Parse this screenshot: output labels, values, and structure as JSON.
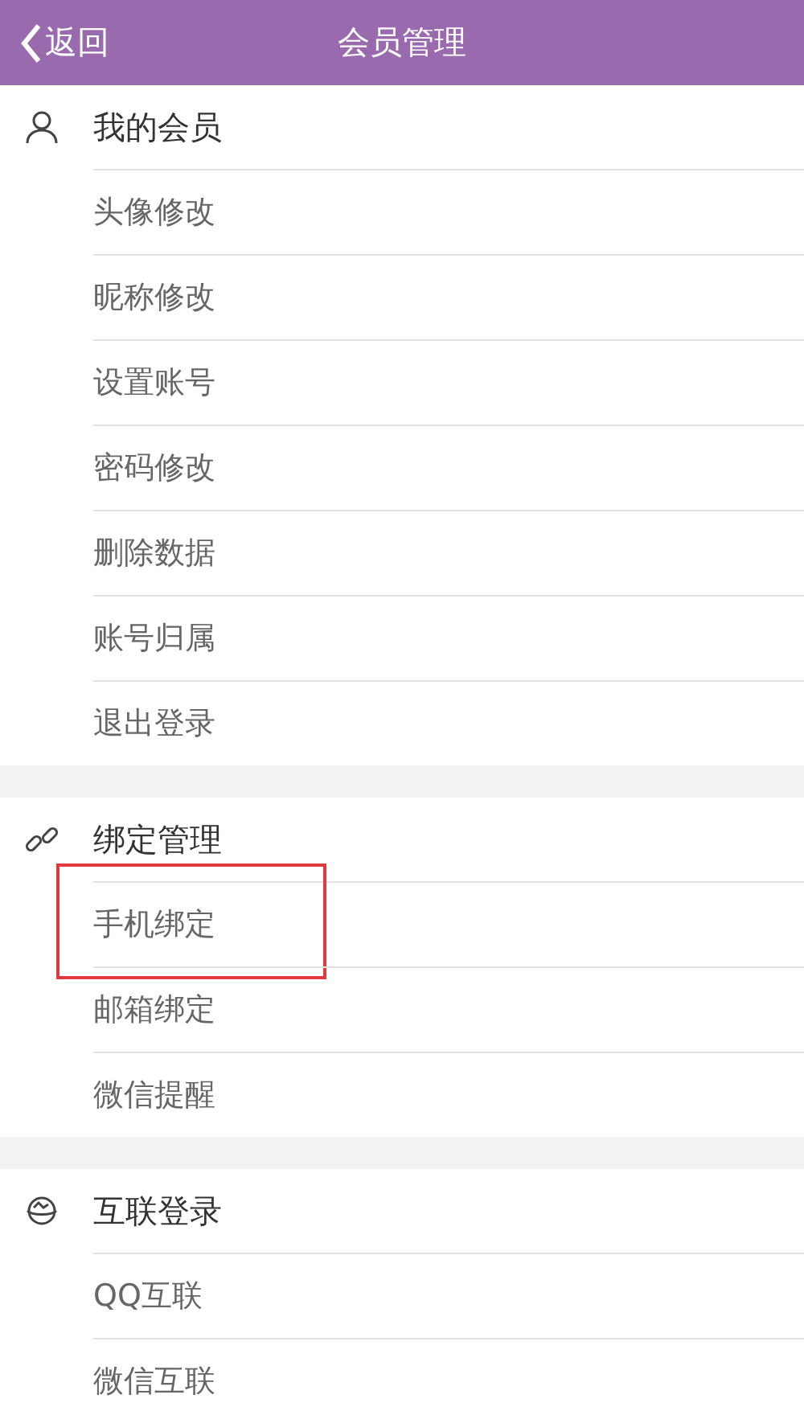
{
  "nav_bar": {
    "back": "返回",
    "title": "会员管理"
  },
  "sections": [
    {
      "kind": "person",
      "title": "我的会员",
      "items": [
        {
          "label": "头像修改",
          "highlighted": false
        },
        {
          "label": "昵称修改",
          "highlighted": false
        },
        {
          "label": "设置账号",
          "highlighted": false
        },
        {
          "label": "密码修改",
          "highlighted": false
        },
        {
          "label": "删除数据",
          "highlighted": false
        },
        {
          "label": "账号归属",
          "highlighted": false
        },
        {
          "label": "退出登录",
          "highlighted": false
        }
      ]
    },
    {
      "kind": "link",
      "title": "绑定管理",
      "items": [
        {
          "label": "手机绑定",
          "highlighted": true
        },
        {
          "label": "邮箱绑定",
          "highlighted": false
        },
        {
          "label": "微信提醒",
          "highlighted": false
        }
      ]
    },
    {
      "kind": "globe",
      "title": "互联登录",
      "items": [
        {
          "label": "QQ互联",
          "highlighted": false
        },
        {
          "label": "微信互联",
          "highlighted": false
        }
      ]
    }
  ]
}
